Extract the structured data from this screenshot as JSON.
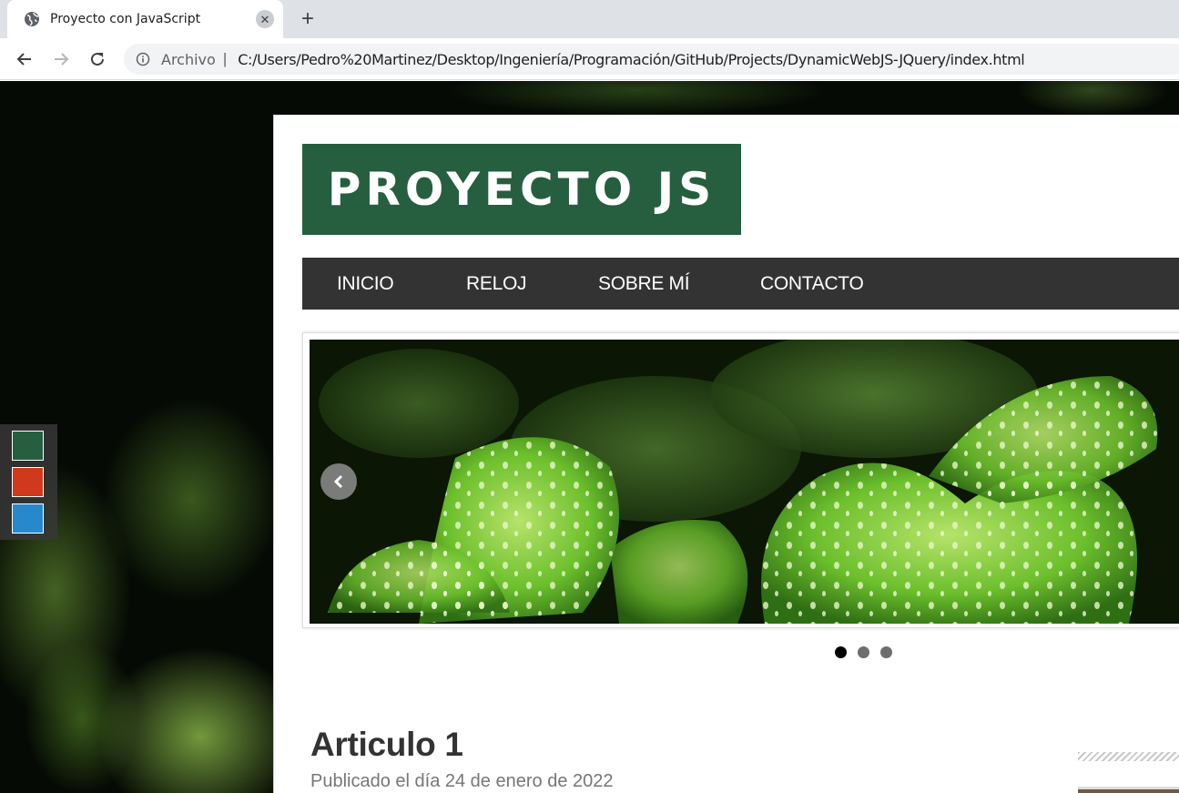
{
  "browser": {
    "tab": {
      "title": "Proyecto con JavaScript",
      "favicon": "globe-icon"
    },
    "address_bar": {
      "scheme_label": "Archivo",
      "separator": "|",
      "url": "C:/Users/Pedro%20Martinez/Desktop/Ingeniería/Programación/GitHub/Projects/DynamicWebJS-JQuery/index.html"
    }
  },
  "page": {
    "logo": "PROYECTO JS",
    "menu": [
      "INICIO",
      "RELOJ",
      "SOBRE MÍ",
      "CONTACTO"
    ],
    "theme_switcher": {
      "colors": [
        "#255f3f",
        "#d0391b",
        "#2789cc"
      ]
    },
    "slider": {
      "slides": 3,
      "active": 0,
      "image": "green leaves with water drops"
    },
    "article": {
      "title": "Articulo 1",
      "date": "Publicado el día 24 de enero de 2022"
    }
  },
  "colors": {
    "brand_green": "#255f3f",
    "menu_bg": "#333333"
  }
}
